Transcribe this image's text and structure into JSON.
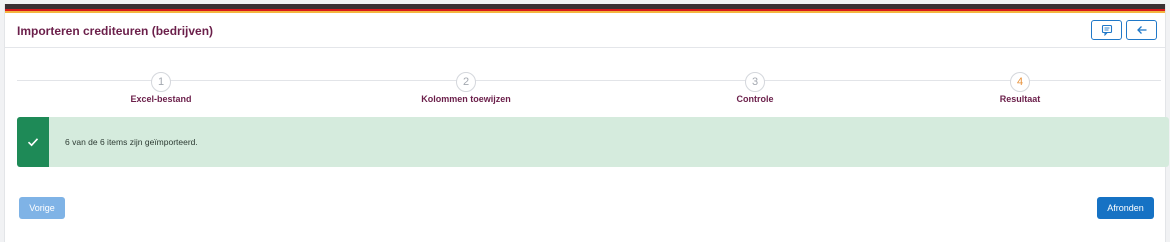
{
  "header": {
    "title": "Importeren crediteuren (bedrijven)",
    "feedback_icon": "feedback-icon",
    "back_icon": "arrow-left-icon"
  },
  "steps": [
    {
      "number": "1",
      "label": "Excel-bestand",
      "active": false
    },
    {
      "number": "2",
      "label": "Kolommen toewijzen",
      "active": false
    },
    {
      "number": "3",
      "label": "Controle",
      "active": false
    },
    {
      "number": "4",
      "label": "Resultaat",
      "active": true
    }
  ],
  "alert": {
    "icon": "check-icon",
    "message": "6 van de 6 items zijn geïmporteerd."
  },
  "buttons": {
    "previous": "Vorige",
    "finish": "Afronden"
  },
  "colors": {
    "brand": "#6b1f4a",
    "primary": "#1672c4",
    "success": "#1e8a57",
    "success_bg": "#d5ebdd",
    "active_step": "#e8913a"
  }
}
